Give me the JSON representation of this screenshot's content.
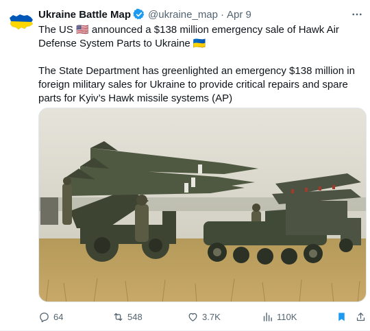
{
  "tweet": {
    "display_name": "Ukraine Battle Map",
    "handle": "@ukraine_map",
    "separator": "·",
    "date": "Apr 9",
    "text_line1": "The US 🇺🇸 announced a $138 million emergency sale of Hawk Air Defense System Parts to Ukraine 🇺🇦",
    "text_line2": "The State Department has greenlighted an emergency $138 million in foreign military sales for Ukraine to provide critical repairs and spare parts for Kyiv’s Hawk missile systems (AP)",
    "more_icon": "more-horizontal-icon"
  },
  "actions": {
    "reply_count": "64",
    "retweet_count": "548",
    "like_count": "3.7K",
    "views_count": "110K"
  },
  "colors": {
    "text": "#0f1419",
    "muted": "#536471",
    "verified_blue": "#1d9bf0",
    "bookmark_blue": "#1d9bf0",
    "flag_blue": "#0057b7",
    "flag_yellow": "#ffd700"
  },
  "icons": [
    "verified-badge-icon",
    "reply-icon",
    "retweet-icon",
    "like-icon",
    "views-icon",
    "bookmark-icon",
    "share-icon"
  ]
}
